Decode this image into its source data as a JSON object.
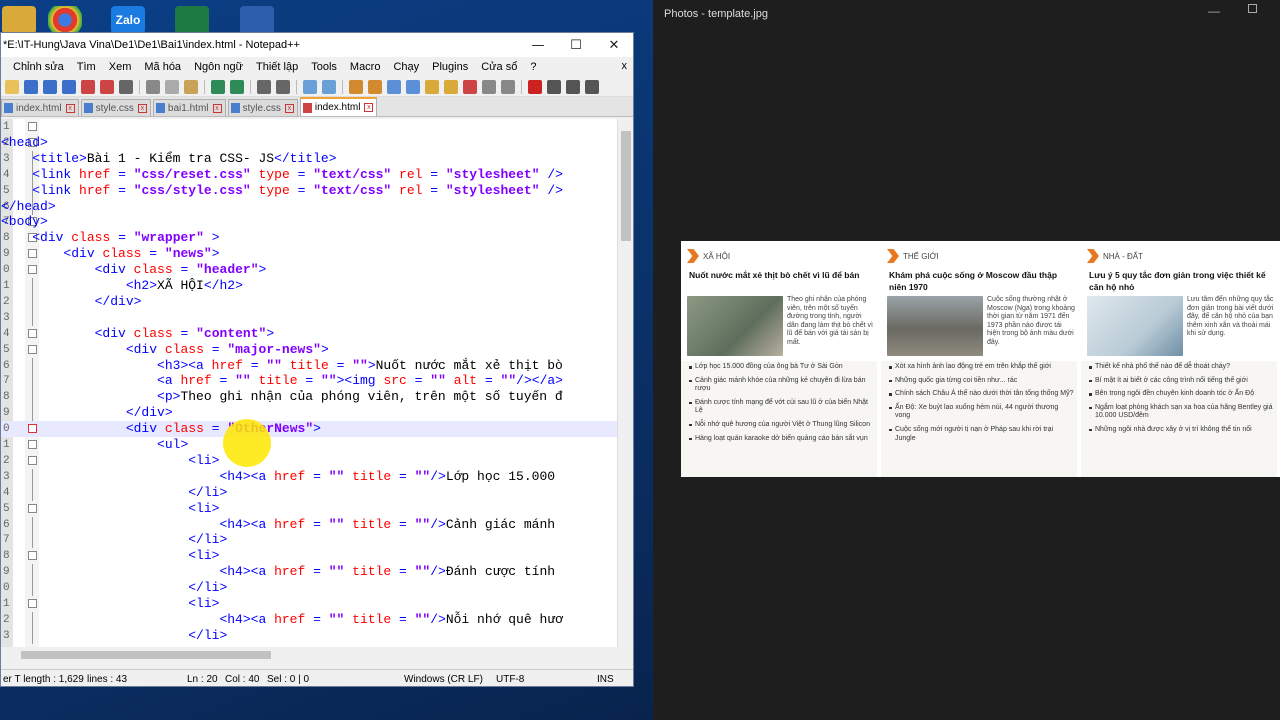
{
  "notepad": {
    "title": "*E:\\IT-Hung\\Java Vina\\De1\\De1\\Bai1\\index.html - Notepad++",
    "menu": [
      "Chỉnh sửa",
      "Tìm",
      "Xem",
      "Mã hóa",
      "Ngôn ngữ",
      "Thiết lập",
      "Tools",
      "Macro",
      "Chạy",
      "Plugins",
      "Cửa sổ",
      "?"
    ],
    "menu_close": "x",
    "tabs": [
      {
        "label": "index.html",
        "active": false
      },
      {
        "label": "style.css",
        "active": false
      },
      {
        "label": "bai1.html",
        "active": false
      },
      {
        "label": "style.css",
        "active": false
      },
      {
        "label": "index.html",
        "active": true
      }
    ],
    "lines": [
      {
        "n": "1",
        "code": "",
        "fold": "box"
      },
      {
        "n": "2",
        "code": "<head>",
        "fold": "box"
      },
      {
        "n": "3",
        "code": "    <title>Bài 1 - Kiểm tra CSS- JS</title>"
      },
      {
        "n": "4",
        "code": "    <link href = \"css/reset.css\" type = \"text/css\" rel = \"stylesheet\" />"
      },
      {
        "n": "5",
        "code": "    <link href = \"css/style.css\" type = \"text/css\" rel = \"stylesheet\" />"
      },
      {
        "n": "6",
        "code": "</head>"
      },
      {
        "n": "7",
        "code": "<body>",
        "fold": "box"
      },
      {
        "n": "8",
        "code": "    <div class = \"wrapper\" >",
        "fold": "box"
      },
      {
        "n": "9",
        "code": "        <div class = \"news\">",
        "fold": "box"
      },
      {
        "n": "0",
        "code": "            <div class = \"header\">",
        "fold": "box"
      },
      {
        "n": "1",
        "code": "                <h2>XÃ HỘI</h2>"
      },
      {
        "n": "2",
        "code": "            </div>"
      },
      {
        "n": "3",
        "code": ""
      },
      {
        "n": "4",
        "code": "            <div class = \"content\">",
        "fold": "box"
      },
      {
        "n": "5",
        "code": "                <div class = \"major-news\">",
        "fold": "box"
      },
      {
        "n": "6",
        "code": "                    <h3><a href = \"\" title = \"\">Nuốt nước mắt xẻ thịt bò"
      },
      {
        "n": "7",
        "code": "                    <a href = \"\" title = \"\"><img src = \"\" alt = \"\"/></a>"
      },
      {
        "n": "8",
        "code": "                    <p>Theo ghi nhận của phóng viên, trên một số tuyến đ"
      },
      {
        "n": "9",
        "code": "                </div>"
      },
      {
        "n": "0",
        "code": "                <div class = \"OtherNews\">",
        "fold": "red",
        "hl": true
      },
      {
        "n": "1",
        "code": "                    <ul>",
        "fold": "box"
      },
      {
        "n": "2",
        "code": "                        <li>",
        "fold": "box"
      },
      {
        "n": "3",
        "code": "                            <h4><a href = \"\" title = \"\"/>Lớp học 15.000"
      },
      {
        "n": "4",
        "code": "                        </li>"
      },
      {
        "n": "5",
        "code": "                        <li>",
        "fold": "box"
      },
      {
        "n": "6",
        "code": "                            <h4><a href = \"\" title = \"\"/>Cảnh giác mánh"
      },
      {
        "n": "7",
        "code": "                        </li>"
      },
      {
        "n": "8",
        "code": "                        <li>",
        "fold": "box"
      },
      {
        "n": "9",
        "code": "                            <h4><a href = \"\" title = \"\"/>Đánh cược tính"
      },
      {
        "n": "0",
        "code": "                        </li>"
      },
      {
        "n": "1",
        "code": "                        <li>",
        "fold": "box"
      },
      {
        "n": "2",
        "code": "                            <h4><a href = \"\" title = \"\"/>Nỗi nhớ quê hươ"
      },
      {
        "n": "3",
        "code": "                        </li>"
      }
    ],
    "status": {
      "length": "er T length : 1,629",
      "lines": "lines : 43",
      "ln": "Ln : 20",
      "col": "Col : 40",
      "sel": "Sel : 0 | 0",
      "eol": "Windows (CR LF)",
      "enc": "UTF-8",
      "ins": "INS"
    }
  },
  "photos": {
    "title": "Photos - template.jpg",
    "min": "—",
    "columns": [
      {
        "tag": "XÃ HỘI",
        "headline": "Nuốt nước mắt xẻ thịt bò chết vì lũ để bán",
        "desc": "Theo ghi nhận của phóng viên, trên một số tuyến đường trong tỉnh, người dân đang làm thịt bò chết vì lũ để bán với giá tài sản bị mất.",
        "img_color": "#7a8a7a",
        "items": [
          "Lớp học 15.000 đồng của ông bà Tư ở Sài Gòn",
          "Cảnh giác mánh khóe của những kẻ chuyên đi lừa bán rượu",
          "Đánh cược tính mạng để vớt củi sau lũ ở của biển Nhật Lệ",
          "Nỗi nhớ quê hương của người Việt ở Thung lũng Silicon",
          "Hàng loạt quán karaoke dở biển quảng cáo bán sắt vụn"
        ]
      },
      {
        "tag": "THẾ GIỚI",
        "headline": "Khám phá cuộc sống ở Moscow đầu thập niên 1970",
        "desc": "Cuộc sống thường nhật ở Moscow (Nga) trong khoảng thời gian từ năm 1971 đến 1973 phần nào được tái hiện trong bộ ảnh màu dưới đây.",
        "img_color": "#6e6e68",
        "items": [
          "Xót xa hình ảnh lao động trẻ em trên khắp thế giới",
          "Những quốc gia từng coi tiền như... rác",
          "Chính sách Châu Á thế nào dưới thời tân tổng thống Mỹ?",
          "Ấn Độ: Xe buýt lao xuống hẻm núi, 44 người thương vong",
          "Cuộc sống mới người tị nạn ở Pháp sau khi rời trại Jungle"
        ]
      },
      {
        "tag": "NHÀ - ĐẤT",
        "headline": "Lưu ý 5 quy tắc đơn giản trong việc thiết kế căn hộ nhỏ",
        "desc": "Lưu tâm đến những quy tắc đơn giản trong bài viết dưới đây, để căn hộ nhỏ của bạn thêm xinh xắn và thoải mái khi sử dụng.",
        "img_color": "#c8d6df",
        "items": [
          "Thiết kế nhà phố thế nào để dễ thoát cháy?",
          "Bí mật ít ai biết ở các công trình nổi tiếng thế giới",
          "Bên trong ngôi đền chuyên kinh doanh tóc ở Ấn Độ",
          "Ngắm loạt phòng khách sạn xa hoa của hãng Bentley giá 10.000 USD/đêm",
          "Những ngôi nhà được xây ở vị trí không thể tin nổi"
        ]
      }
    ]
  },
  "colors": {
    "tag": "#0000ff",
    "attr": "#ff0000",
    "string": "#8000ff",
    "accent": "#e8781f"
  }
}
